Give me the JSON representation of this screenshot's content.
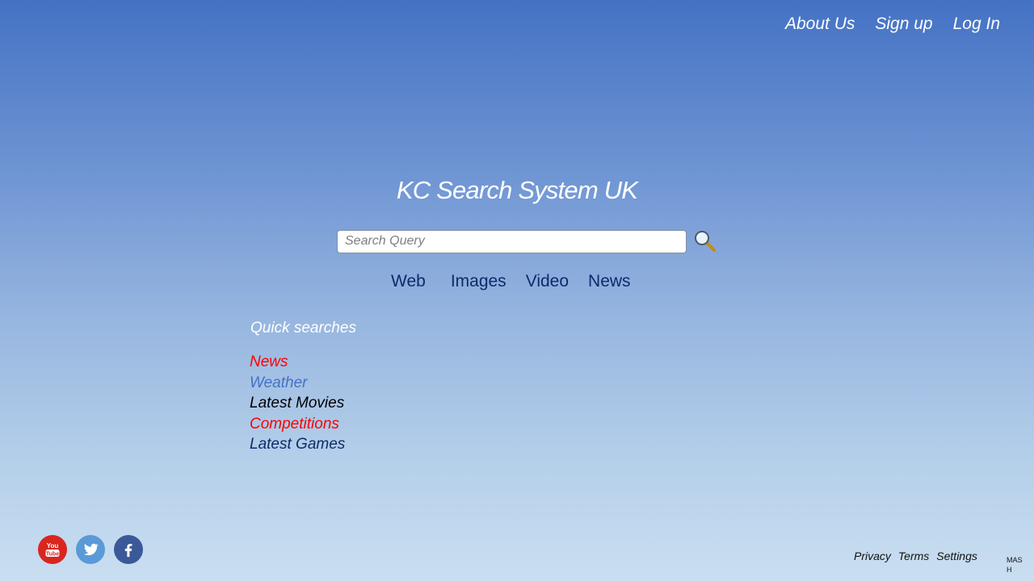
{
  "top_nav": {
    "items": [
      "About Us",
      "Sign up",
      "Log In"
    ]
  },
  "site_title": "KC Search System UK",
  "search": {
    "placeholder": "Search Query",
    "value": "",
    "button_icon": "magnifier-icon"
  },
  "tabs": [
    "Web",
    "Images",
    "Video",
    "News"
  ],
  "quick_searches": {
    "title": "Quick searches",
    "items": [
      {
        "label": "News",
        "color": "#ff0000"
      },
      {
        "label": "Weather",
        "color": "#4472c4"
      },
      {
        "label": "Latest Movies",
        "color": "#000000"
      },
      {
        "label": "Competitions",
        "color": "#ff0000"
      },
      {
        "label": "Latest Games",
        "color": "#0e2a6b"
      }
    ]
  },
  "social": [
    {
      "icon": "youtube-icon",
      "color": "#d9261f"
    },
    {
      "icon": "twitter-icon",
      "color": "#5a9ad6"
    },
    {
      "icon": "facebook-icon",
      "color": "#3b5998"
    }
  ],
  "footer": {
    "links": [
      "Privacy",
      "Terms",
      "Settings"
    ],
    "corner_text": "MASH"
  }
}
